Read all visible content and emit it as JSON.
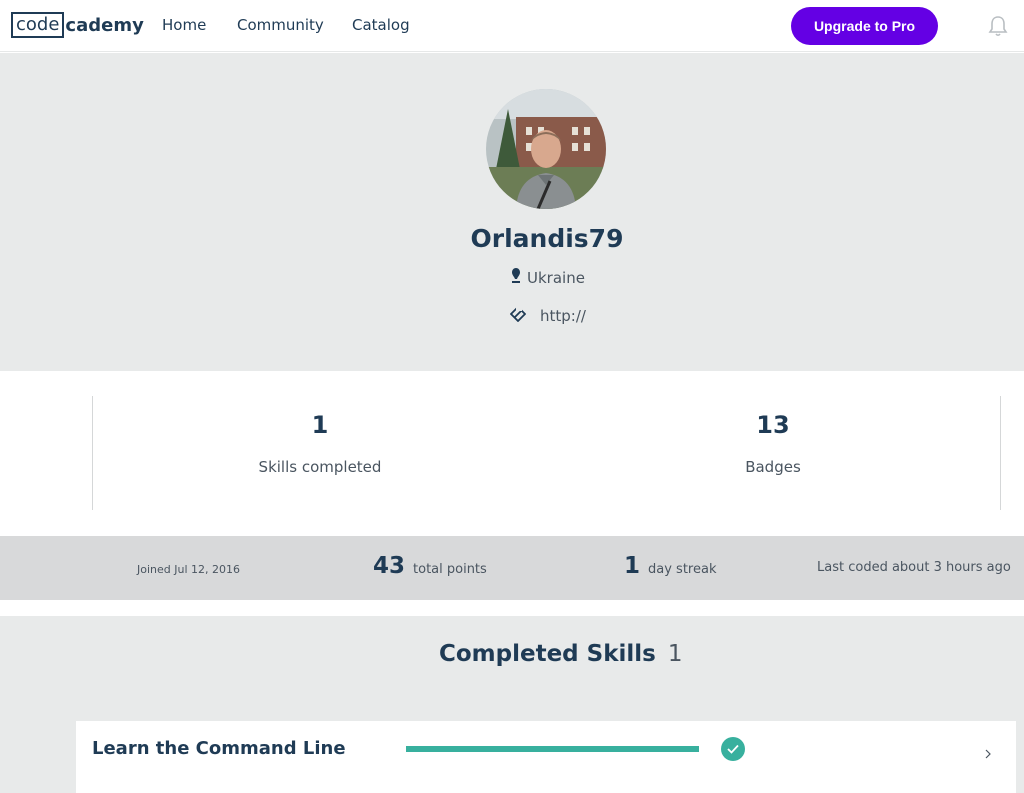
{
  "header": {
    "logo_box": "code",
    "logo_rest": "cademy",
    "nav": [
      "Home",
      "Community",
      "Catalog"
    ],
    "upgrade_label": "Upgrade to Pro",
    "icons": [
      "bell-icon"
    ]
  },
  "profile": {
    "username": "Orlandis79",
    "location": "Ukraine",
    "website": "http://",
    "icons": [
      "location-pin-icon",
      "link-icon"
    ]
  },
  "stats": {
    "skills_completed_value": "1",
    "skills_completed_label": "Skills completed",
    "badges_value": "13",
    "badges_label": "Badges"
  },
  "info": {
    "joined": "Joined Jul 12, 2016",
    "points_value": "43",
    "points_label": "total points",
    "streak_value": "1",
    "streak_label": "day streak",
    "last_coded": "Last coded about 3 hours ago"
  },
  "skills": {
    "title": "Completed Skills",
    "count": "1",
    "items": [
      {
        "name": "Learn the Command Line",
        "progress": 1.0,
        "completed": true
      }
    ]
  },
  "colors": {
    "brand_purple": "#6400e4",
    "navy": "#1f3b55",
    "teal": "#38b09e",
    "gray_bg": "#e8eaea"
  }
}
